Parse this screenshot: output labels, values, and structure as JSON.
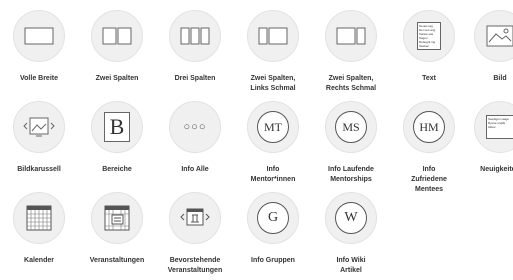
{
  "tiles": [
    {
      "label": "Volle Breite",
      "icon": "full-width-layout-icon"
    },
    {
      "label": "Zwei Spalten",
      "icon": "two-column-layout-icon"
    },
    {
      "label": "Drei Spalten",
      "icon": "three-column-layout-icon"
    },
    {
      "label": "Zwei Spalten,\nLinks Schmal",
      "icon": "two-column-left-narrow-icon"
    },
    {
      "label": "Zwei Spalten,\nRechts Schmal",
      "icon": "two-column-right-narrow-icon"
    },
    {
      "label": "Text",
      "icon": "text-block-icon",
      "preview": "Neues tag. Der text ang Tekste sas Sagen Rottegrit ing Seeken"
    },
    {
      "label": "Bild",
      "icon": "image-icon"
    },
    {
      "label": "Bildkarussell",
      "icon": "image-carousel-icon"
    },
    {
      "label": "Bereiche",
      "icon": "sections-icon",
      "glyph": "B"
    },
    {
      "label": "Info Alle",
      "icon": "info-all-icon",
      "glyph": "○○○"
    },
    {
      "label": "Info\nMentor*innen",
      "icon": "info-mentors-icon",
      "glyph": "MT"
    },
    {
      "label": "Info Laufende\nMentorships",
      "icon": "info-mentorships-icon",
      "glyph": "MS"
    },
    {
      "label": "Info\nZufriedene\nMentees",
      "icon": "info-mentees-icon",
      "glyph": "HM"
    },
    {
      "label": "Neuigkeiten",
      "icon": "news-icon",
      "preview": "Seedigom aage Ryese englik Aktes"
    },
    {
      "label": "Kalender",
      "icon": "calendar-icon"
    },
    {
      "label": "Veranstaltungen",
      "icon": "events-icon"
    },
    {
      "label": "Bevorstehende\nVeranstaltungen",
      "icon": "upcoming-events-icon"
    },
    {
      "label": "Info Gruppen",
      "icon": "info-groups-icon",
      "glyph": "G"
    },
    {
      "label": "Info Wiki\nArtikel",
      "icon": "info-wiki-icon",
      "glyph": "W"
    }
  ]
}
